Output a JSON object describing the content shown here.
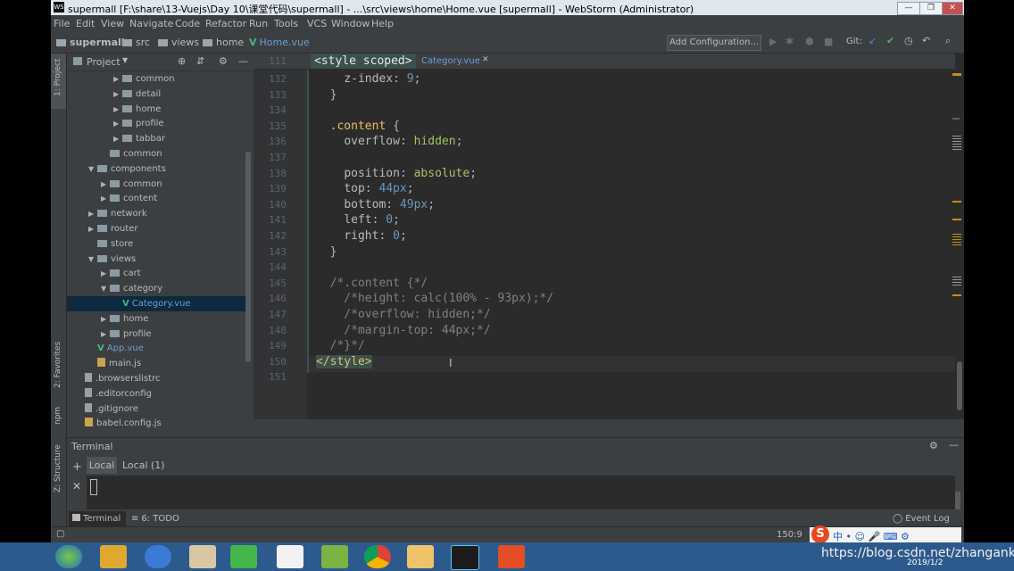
{
  "window": {
    "title": "supermall [F:\\share\\13-Vuejs\\Day 10\\课堂代码\\supermall] - ...\\src\\views\\home\\Home.vue [supermall] - WebStorm (Administrator)"
  },
  "menu": [
    "File",
    "Edit",
    "View",
    "Navigate",
    "Code",
    "Refactor",
    "Run",
    "Tools",
    "VCS",
    "Window",
    "Help"
  ],
  "breadcrumb": [
    "supermall",
    "src",
    "views",
    "home",
    "Home.vue"
  ],
  "toolbar": {
    "add_config": "Add Configuration...",
    "git_label": "Git:"
  },
  "left_strip": {
    "project": "1: Project",
    "favorites": "2: Favorites",
    "npm": "npm",
    "structure": "Z: Structure"
  },
  "project_panel": {
    "title": "Project",
    "tree": [
      {
        "label": "common",
        "depth": 3,
        "type": "folder",
        "arrow": "▶"
      },
      {
        "label": "detail",
        "depth": 3,
        "type": "folder",
        "arrow": "▶"
      },
      {
        "label": "home",
        "depth": 3,
        "type": "folder",
        "arrow": "▶"
      },
      {
        "label": "profile",
        "depth": 3,
        "type": "folder",
        "arrow": "▶"
      },
      {
        "label": "tabbar",
        "depth": 3,
        "type": "folder",
        "arrow": "▶"
      },
      {
        "label": "common",
        "depth": 2,
        "type": "folder",
        "arrow": ""
      },
      {
        "label": "components",
        "depth": 1,
        "type": "folder",
        "arrow": "▼"
      },
      {
        "label": "common",
        "depth": 2,
        "type": "folder",
        "arrow": "▶"
      },
      {
        "label": "content",
        "depth": 2,
        "type": "folder",
        "arrow": "▶"
      },
      {
        "label": "network",
        "depth": 1,
        "type": "folder",
        "arrow": "▶"
      },
      {
        "label": "router",
        "depth": 1,
        "type": "folder",
        "arrow": "▶"
      },
      {
        "label": "store",
        "depth": 1,
        "type": "folder",
        "arrow": ""
      },
      {
        "label": "views",
        "depth": 1,
        "type": "folder",
        "arrow": "▼"
      },
      {
        "label": "cart",
        "depth": 2,
        "type": "folder",
        "arrow": "▶"
      },
      {
        "label": "category",
        "depth": 2,
        "type": "folder",
        "arrow": "▼"
      },
      {
        "label": "Category.vue",
        "depth": 3,
        "type": "vue",
        "arrow": "",
        "selected": true
      },
      {
        "label": "home",
        "depth": 2,
        "type": "folder",
        "arrow": "▶"
      },
      {
        "label": "profile",
        "depth": 2,
        "type": "folder",
        "arrow": "▶"
      },
      {
        "label": "App.vue",
        "depth": 1,
        "type": "vue",
        "arrow": ""
      },
      {
        "label": "main.js",
        "depth": 1,
        "type": "js",
        "arrow": ""
      },
      {
        "label": ".browserslistrc",
        "depth": 0,
        "type": "file",
        "arrow": ""
      },
      {
        "label": ".editorconfig",
        "depth": 0,
        "type": "file",
        "arrow": ""
      },
      {
        "label": ".gitignore",
        "depth": 0,
        "type": "file",
        "arrow": ""
      },
      {
        "label": "babel.config.js",
        "depth": 0,
        "type": "js",
        "arrow": ""
      }
    ]
  },
  "editor": {
    "sticky_line": "111",
    "sticky_text": "<style scoped>",
    "tab_label": "Category.vue",
    "lines": [
      {
        "n": "132",
        "parts": [
          [
            "    ",
            "p"
          ],
          [
            "z-index",
            "prop"
          ],
          [
            ": ",
            "p"
          ],
          [
            "9",
            "num"
          ],
          [
            ";",
            "p"
          ]
        ]
      },
      {
        "n": "133",
        "parts": [
          [
            "  }",
            "p"
          ]
        ]
      },
      {
        "n": "134",
        "parts": []
      },
      {
        "n": "135",
        "parts": [
          [
            "  ",
            "p"
          ],
          [
            ".content",
            "sel"
          ],
          [
            " {",
            "p"
          ]
        ]
      },
      {
        "n": "136",
        "parts": [
          [
            "    ",
            "p"
          ],
          [
            "overflow",
            "prop"
          ],
          [
            ": ",
            "p"
          ],
          [
            "hidden",
            "val"
          ],
          [
            ";",
            "p"
          ]
        ]
      },
      {
        "n": "137",
        "parts": []
      },
      {
        "n": "138",
        "parts": [
          [
            "    ",
            "p"
          ],
          [
            "position",
            "prop"
          ],
          [
            ": ",
            "p"
          ],
          [
            "absolute",
            "val"
          ],
          [
            ";",
            "p"
          ]
        ]
      },
      {
        "n": "139",
        "parts": [
          [
            "    ",
            "p"
          ],
          [
            "top",
            "prop"
          ],
          [
            ": ",
            "p"
          ],
          [
            "44px",
            "num"
          ],
          [
            ";",
            "p"
          ]
        ]
      },
      {
        "n": "140",
        "parts": [
          [
            "    ",
            "p"
          ],
          [
            "bottom",
            "prop"
          ],
          [
            ": ",
            "p"
          ],
          [
            "49px",
            "num"
          ],
          [
            ";",
            "p"
          ]
        ]
      },
      {
        "n": "141",
        "parts": [
          [
            "    ",
            "p"
          ],
          [
            "left",
            "prop"
          ],
          [
            ": ",
            "p"
          ],
          [
            "0",
            "num"
          ],
          [
            ";",
            "p"
          ]
        ]
      },
      {
        "n": "142",
        "parts": [
          [
            "    ",
            "p"
          ],
          [
            "right",
            "prop"
          ],
          [
            ": ",
            "p"
          ],
          [
            "0",
            "num"
          ],
          [
            ";",
            "p"
          ]
        ]
      },
      {
        "n": "143",
        "parts": [
          [
            "  }",
            "p"
          ]
        ]
      },
      {
        "n": "144",
        "parts": []
      },
      {
        "n": "145",
        "parts": [
          [
            "  /*.content {*/",
            "cmt"
          ]
        ]
      },
      {
        "n": "146",
        "parts": [
          [
            "    /*height: calc(100% - 93px);*/",
            "cmt"
          ]
        ]
      },
      {
        "n": "147",
        "parts": [
          [
            "    /*overflow: hidden;*/",
            "cmt"
          ]
        ]
      },
      {
        "n": "148",
        "parts": [
          [
            "    /*margin-top: 44px;*/",
            "cmt"
          ]
        ]
      },
      {
        "n": "149",
        "parts": [
          [
            "  /*}*/",
            "cmt"
          ]
        ]
      },
      {
        "n": "150",
        "parts": [
          [
            "</style>",
            "tag"
          ]
        ]
      },
      {
        "n": "151",
        "parts": []
      }
    ]
  },
  "terminal": {
    "title": "Terminal",
    "tabs": [
      "Local",
      "Local (1)"
    ]
  },
  "bottom_tabs": {
    "terminal": "Terminal",
    "todo": "6: TODO",
    "event_log": "Event Log"
  },
  "status": {
    "position": "150:9",
    "date": "2019/1/2"
  },
  "watermark": "https://blog.csdn.net/zhangank",
  "colors": {
    "accent": "#4a88c7",
    "selection": "#0d293e"
  }
}
